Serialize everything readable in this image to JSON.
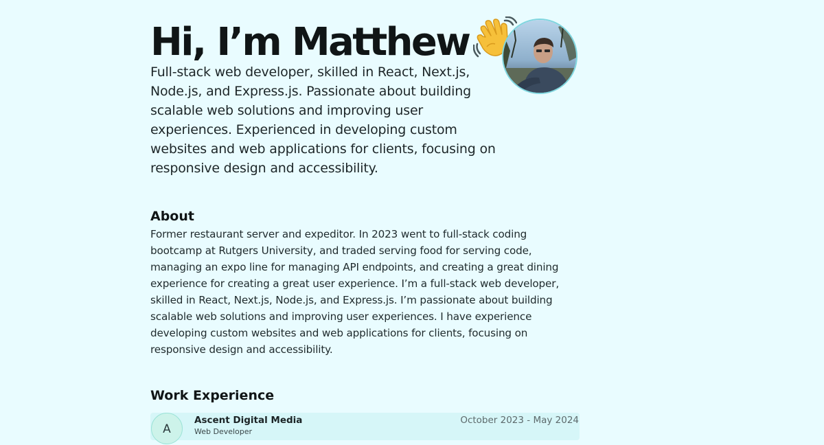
{
  "hero": {
    "greeting": "Hi, I’m Matthew",
    "wave_emoji": "waving-hand-icon",
    "description": "Full-stack web developer, skilled in React, Next.js, Node.js, and Express.js. Passionate about building scalable web solutions and improving user experiences. Experienced in developing custom websites and web applications for clients, focusing on responsive design and accessibility.",
    "avatar_alt": "Matthew"
  },
  "about": {
    "heading": "About",
    "text": "Former restaurant server and expeditor. In 2023 went to full-stack coding bootcamp at Rutgers University, and traded serving food for serving code, managing an expo line for managing API endpoints, and creating a great dining experience for creating a great user experience. I’m a full-stack web developer, skilled in React, Next.js, Node.js, and Express.js. I’m passionate about building scalable web solutions and improving user experiences. I have experience developing custom websites and web applications for clients, focusing on responsive design and accessibility."
  },
  "work": {
    "heading": "Work Experience",
    "items": [
      {
        "logo_letter": "A",
        "company": "Ascent Digital Media",
        "title": "Web Developer",
        "dates": "October 2023 - May 2024"
      }
    ]
  },
  "colors": {
    "background": "#e9fcff",
    "text": "#1b2426",
    "accent": "#7fd6df",
    "card": "#d6f6f8"
  }
}
